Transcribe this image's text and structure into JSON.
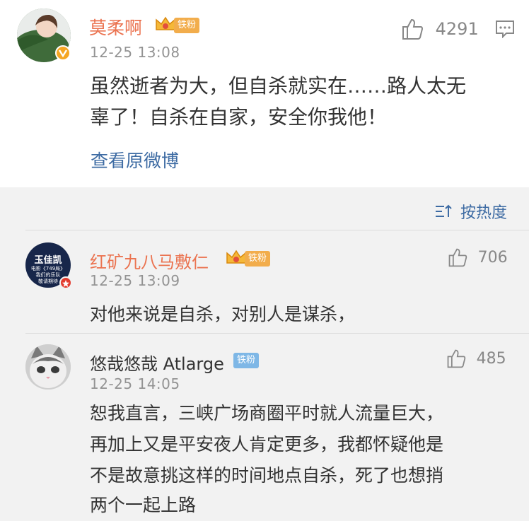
{
  "main_post": {
    "username": "莫柔啊",
    "badge": "铁粉",
    "likes": "4291",
    "time": "12-25 13:08",
    "text_lines": [
      "虽然逝者为大，但自杀就实在……路人太无",
      "辜了！自杀在自家，安全你我他！"
    ],
    "view_original": "查看原微博",
    "colors": {
      "username": "#eb7350",
      "link": "#3d6ba3",
      "badge": "#f2ad4c"
    }
  },
  "sort": {
    "label": "按热度",
    "icon": "sort-icon"
  },
  "comments": [
    {
      "username": "红矿九八马敷仁",
      "badge": "铁粉",
      "likes": "706",
      "time": "12-25 13:09",
      "text_lines": [
        "对他来说是自杀，对别人是谋杀，"
      ],
      "avatar_text": [
        "玉佳凯",
        "电影《749局》",
        "我们的乐队",
        "敬请期待"
      ]
    },
    {
      "username": "悠哉悠哉 Atlarge",
      "badge": "铁粉",
      "likes": "485",
      "time": "12-25 14:05",
      "text_lines": [
        "恕我直言，三峡广场商圈平时就人流量巨大，",
        "再加上又是平安夜人肯定更多，我都怀疑他是",
        "不是故意挑这样的时间地点自杀，死了也想捎",
        "两个一起上路"
      ]
    }
  ]
}
